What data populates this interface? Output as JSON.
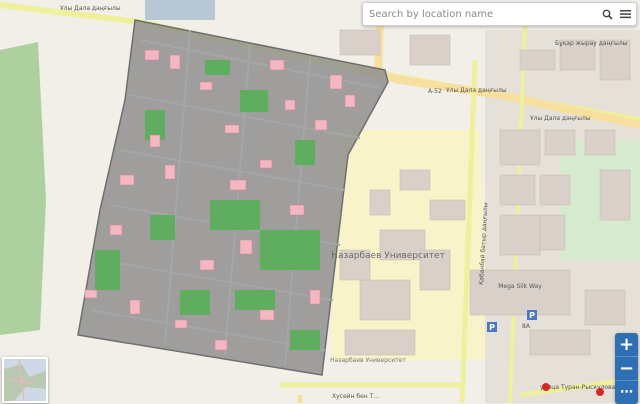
{
  "search": {
    "placeholder": "Search by location name"
  },
  "icons": {
    "search": "magnifier-icon",
    "menu": "hamburger-menu-icon",
    "layers": "layer-minimap-icon"
  },
  "zoom": {
    "in_label": "+",
    "out_label": "−",
    "more_label": "⋯"
  },
  "map": {
    "roads": {
      "top_north": "Ұлы Дала даңғылы",
      "top_a52": "A-52",
      "top_right": "Ұлы Дала даңғылы",
      "mid_right": "Ұлы Дала даңғылы",
      "bukhar": "Бұқар жырау даңғылы",
      "kabanbai": "Қабанбай батыр даңғылы",
      "bottom_husein": "Хусейн бен Т...",
      "bottom_turan": "улица Туран-Рыскулова"
    },
    "places": {
      "university": "Назарбаев Университет",
      "university_small": "Назарбаев Университет",
      "mega": "Mega Silk Way",
      "parking": "P",
      "parking2": "P",
      "parking_count": "8A"
    }
  },
  "colors": {
    "background": "#f2efe9",
    "overlay": "#8c8c8c",
    "building": "#f4b6c0",
    "park": "#6bb36b",
    "university": "#f8f3c8",
    "road_major": "#f7dfa0",
    "road_yellow": "#eef09c",
    "zoom_button": "#2f6fb4"
  }
}
